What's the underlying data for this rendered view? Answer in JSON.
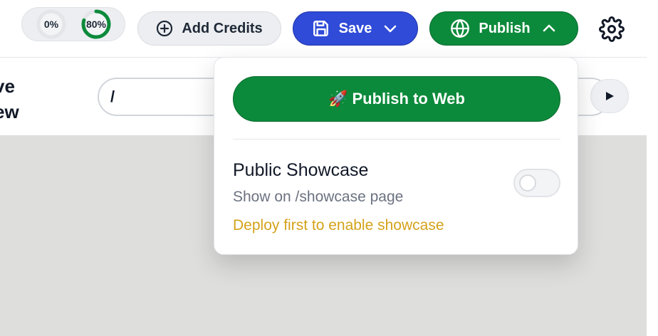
{
  "toolbar": {
    "usage": [
      {
        "label": "0%",
        "fraction": 0.0
      },
      {
        "label": "80%",
        "fraction": 0.8
      }
    ],
    "add_credits_label": "Add Credits",
    "save_label": "Save",
    "publish_label": "Publish",
    "icons": {
      "add_credits": "plus-circle-icon",
      "save": "floppy-disk-icon",
      "save_menu": "chevron-down-icon",
      "publish": "globe-icon",
      "publish_menu": "chevron-up-icon",
      "settings": "gear-icon"
    }
  },
  "preview": {
    "title": "ve\new",
    "path_value": "/",
    "play_icon": "play-icon"
  },
  "publish_menu": {
    "publish_to_web_label": "🚀 Publish to Web",
    "showcase": {
      "title": "Public Showcase",
      "subtitle": "Show on /showcase page",
      "warning": "Deploy first to enable showcase",
      "enabled": false
    }
  },
  "colors": {
    "save_blue": "#2f4bd8",
    "publish_green": "#0c8a3b",
    "usage_ring_green": "#0c8a3b",
    "warning_yellow": "#d4a21a",
    "preview_bg": "#dededd"
  }
}
